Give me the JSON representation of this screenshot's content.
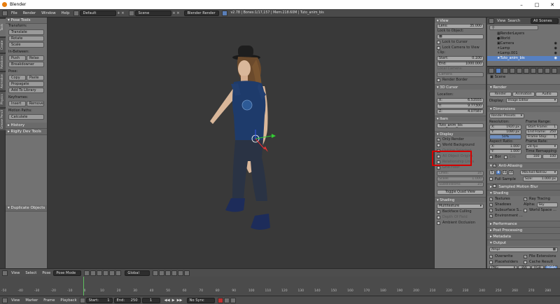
{
  "window": {
    "title": "Blender"
  },
  "menu": {
    "items": [
      "File",
      "Render",
      "Window",
      "Help"
    ],
    "layout": "Default",
    "scene": "Scene",
    "engine": "Blender Render",
    "stats": "v2.78 | Bones:1/17,157 | Mem:218.60M | Tuto_anim_bis"
  },
  "toolshelf": {
    "tabs": [
      "Tools",
      "Create",
      "Relations",
      "Animation",
      "Physics",
      "Grease Pencil"
    ],
    "header": "Pose Tools",
    "transform_label": "Transform:",
    "transform": [
      "Translate",
      "Rotate",
      "Scale"
    ],
    "inbetween_label": "In-Between:",
    "push": "Push",
    "relax": "Relax",
    "breakdowner": "Breakdowner",
    "pose_label": "Pose:",
    "copy": "Copy",
    "paste": "Paste",
    "propagate": "Propagate",
    "add_library": "Add To Library",
    "keyframes_label": "Keyframes:",
    "insert": "Insert",
    "remove": "Remove",
    "motion_label": "Motion Paths:",
    "calculate": "Calculate",
    "history": "History",
    "rigify": "Rigify Dev Tools",
    "duplicate": "Duplicate Objects"
  },
  "npanel": {
    "view_header": "View",
    "lens_label": "Lens:",
    "lens": "35.000",
    "lock_object": "Lock to Object:",
    "lock_cursor": "Lock to Cursor",
    "lock_camera": "Lock Camera to View",
    "clip": "Clip:",
    "clip_start_label": "Start:",
    "clip_start": "0.100",
    "clip_end_label": "End:",
    "clip_end": "1000.000",
    "local_camera": "Local Camera:",
    "camera_field": "Camera",
    "render_border": "Render Border",
    "cursor_header": "3D Cursor",
    "location": "Location:",
    "cx_label": "X:",
    "cx": "6.53555",
    "cy_label": "Y:",
    "cy": "9.77300",
    "cz_label": "Z:",
    "cz": "4.07587",
    "item_header": "Item",
    "item_name": "Tuto_anim_bis",
    "display_header": "Display",
    "only_render": "Only Render",
    "world_bg": "World Background",
    "outline": "Outline Selected",
    "all_origins": "All Object Origins",
    "relationship": "Relationship Lines",
    "grid_floor": "Grid Floor",
    "lines_label": "Lines:",
    "lines": "16",
    "scale_label": "Scale:",
    "scale": "1.000",
    "subdiv_label": "Subdivisions:",
    "subdiv": "10",
    "toggle_quad": "Toggle Quad View",
    "shading_header": "Shading",
    "shading_mode": "Multitexture",
    "backface": "Backface Culling",
    "depth_dof": "Depth Of Field",
    "ambient": "Ambient Occlusion"
  },
  "outliner": {
    "view": "View",
    "search": "Search",
    "scenes": "All Scenes",
    "items": [
      "RenderLayers",
      "World",
      "Camera",
      "Lamp",
      "Lamp.001",
      "Tuto_anim_bis"
    ]
  },
  "props": {
    "breadcrumb": "Scene",
    "render_header": "Render",
    "render_btn": "Render",
    "anim_btn": "Animation",
    "audio_btn": "Audio",
    "display_label": "Display:",
    "display_val": "Image Editor",
    "dims_header": "Dimensions",
    "presets": "Render Presets",
    "resolution": "Resolution:",
    "frame_range": "Frame Range:",
    "resx_label": "X:",
    "resx": "1920 px",
    "resy_label": "Y:",
    "resy": "1080 px",
    "respct": "50%",
    "start_label": "Start Frame:",
    "start": "1",
    "end_label": "End Frame:",
    "end": "250",
    "step_label": "Frame Step:",
    "step": "1",
    "aspect": "Aspect Ratio:",
    "framerate": "Frame Rate:",
    "ax_label": "X:",
    "ax": "1.000",
    "ay_label": "Y:",
    "ay": "1.000",
    "fps": "24 fps",
    "remap": "Time Remapping:",
    "remap_old": "100",
    "remap_new": "100",
    "border": "Bor",
    "crop": "Cro",
    "aa_header": "Anti-Aliasing",
    "aa_samples": [
      "5",
      "8",
      "11",
      "16"
    ],
    "aa_filter": "Mitchell-Netrav",
    "full_sample": "Full Sample",
    "size_label": "Size:",
    "size": "1.000 px",
    "motion_blur": "Sampled Motion Blur",
    "shading_header": "Shading",
    "textures": "Textures",
    "ray": "Ray Tracing",
    "shadows": "Shadows",
    "alpha_label": "Alpha:",
    "alpha": "Sky",
    "sss": "Subsurface S...",
    "world_space": "World Space ...",
    "environment": "Environment ...",
    "performance": "Performance",
    "post": "Post Processing",
    "metadata": "Metadata",
    "output_header": "Output",
    "output_path": "/tmp/",
    "overwrite": "Overwrite",
    "file_ext": "File Extensions",
    "placeholders": "Placeholders",
    "cache": "Cache Result",
    "format": "PNG",
    "bw": "BW",
    "rgb": "RGB",
    "rgba": "RGBA"
  },
  "vpheader": {
    "view": "View",
    "select": "Select",
    "pose": "Pose",
    "mode": "Pose Mode",
    "orientation": "Global"
  },
  "timeline": {
    "ticks": [
      "-50",
      "-40",
      "-30",
      "-20",
      "-10",
      "0",
      "10",
      "20",
      "30",
      "40",
      "50",
      "60",
      "70",
      "80",
      "90",
      "100",
      "110",
      "120",
      "130",
      "140",
      "150",
      "160",
      "170",
      "180",
      "190",
      "200",
      "210",
      "220",
      "230",
      "240",
      "250",
      "260",
      "270",
      "280"
    ],
    "view": "View",
    "marker": "Marker",
    "frame": "Frame",
    "playback": "Playback",
    "start_label": "Start:",
    "start": "1",
    "end_label": "End:",
    "end": "250",
    "current": "1",
    "sync": "No Sync"
  }
}
